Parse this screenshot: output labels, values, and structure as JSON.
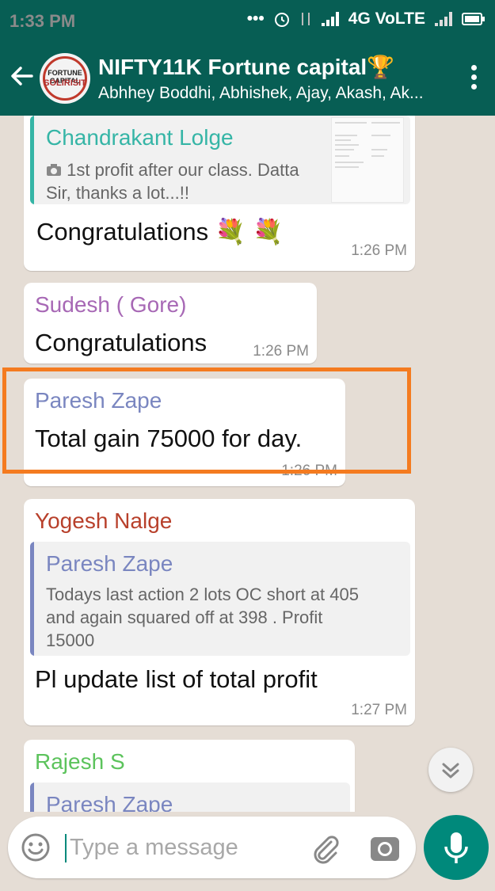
{
  "status_bar": {
    "time": "1:33 PM",
    "network": "4G VoLTE",
    "icons": [
      "dots-icon",
      "alarm-icon",
      "data-arrows-icon",
      "signal-icon",
      "signal-icon-2",
      "battery-icon"
    ]
  },
  "header": {
    "group_name": "NIFTY11K Fortune capital🏆",
    "participants": "Abhhey Boddhi, Abhishek, Ajay, Akash, Ak...",
    "avatar_text_top": "FORTUNE CAPITAL",
    "avatar_text_main": "SOLIRISIT"
  },
  "messages": [
    {
      "sender": "Chandrakant Lolge",
      "sender_color": "#35b5a6",
      "quote_text": "1st profit after our class. Datta Sir, thanks a lot...!!",
      "text": "Congratulations 💐 💐",
      "time": "1:26 PM"
    },
    {
      "sender": "Sudesh ( Gore)",
      "sender_color": "#a768b5",
      "text": "Congratulations",
      "time": "1:26 PM"
    },
    {
      "sender": "Paresh Zape",
      "sender_color": "#7a86c0",
      "text": "Total gain 75000 for day.",
      "time": "1:26 PM"
    },
    {
      "sender": "Yogesh Nalge",
      "sender_color": "#b8402b",
      "quote_name": "Paresh Zape",
      "quote_text_line1": "Todays last action 2 lots OC short at 405",
      "quote_text_line2": "and again squared off at 398 . Profit",
      "quote_text_line3": "15000",
      "text": "Pl update list of total profit",
      "time": "1:27 PM"
    },
    {
      "sender": "Rajesh S",
      "sender_color": "#5cc35c",
      "quote_name": "Paresh Zape"
    }
  ],
  "composer": {
    "placeholder": "Type a message"
  },
  "colors": {
    "header": "#075e54",
    "accent": "#00897b",
    "highlight": "#f47b20"
  }
}
